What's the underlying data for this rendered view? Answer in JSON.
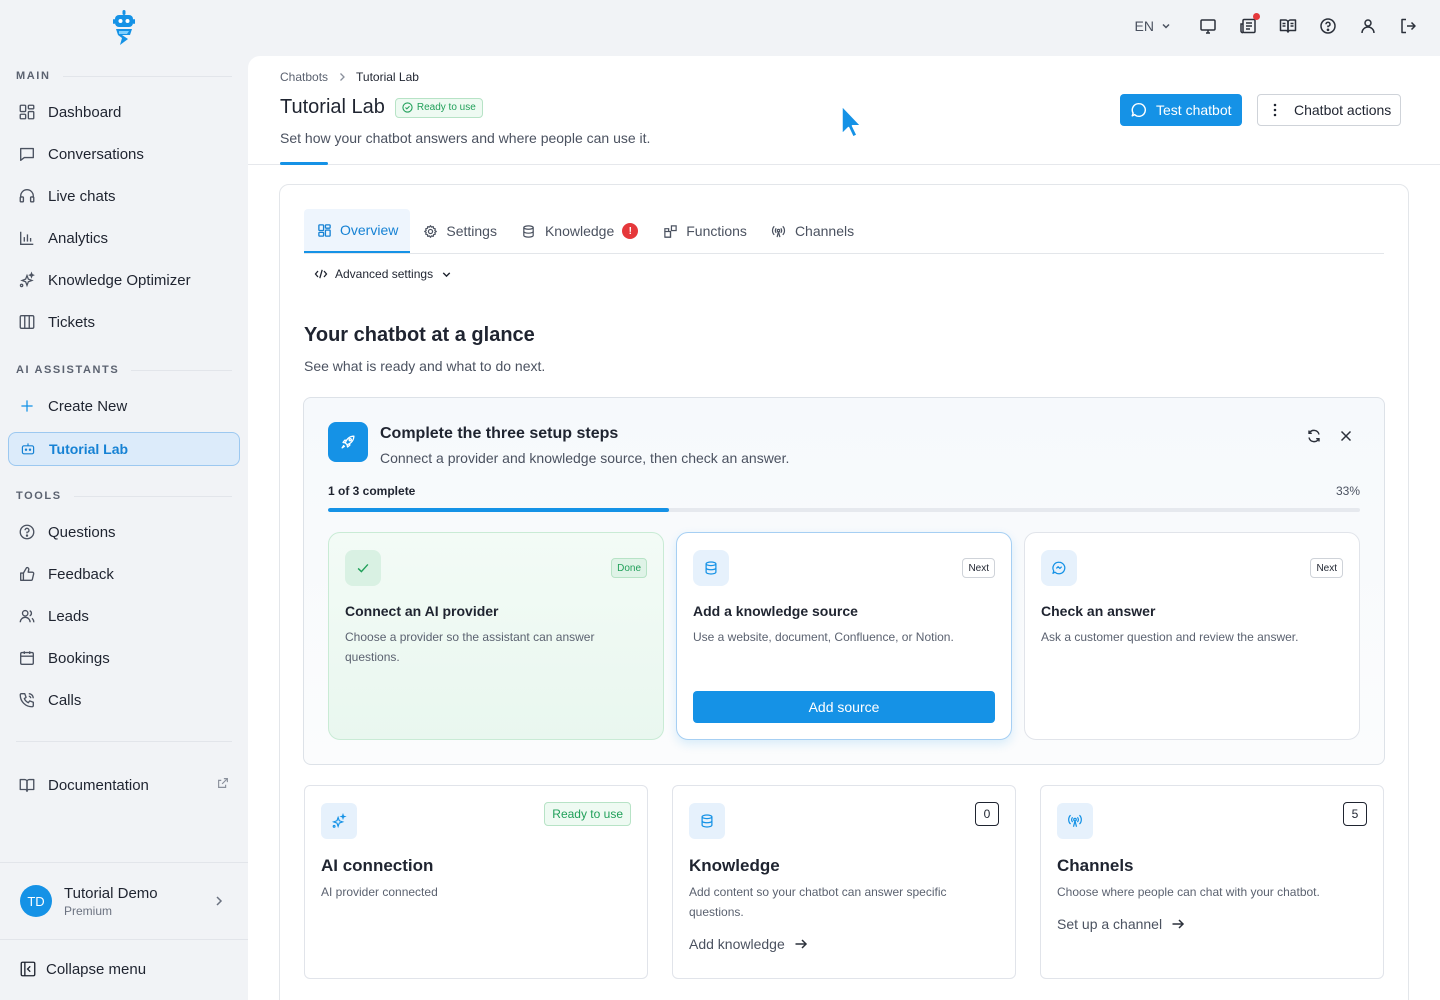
{
  "sidebar": {
    "sections": {
      "main": "MAIN",
      "ai_assistants": "AI ASSISTANTS",
      "tools": "TOOLS"
    },
    "main_items": [
      {
        "label": "Dashboard",
        "icon": "dashboard-icon"
      },
      {
        "label": "Conversations",
        "icon": "chat-icon"
      },
      {
        "label": "Live chats",
        "icon": "headset-icon"
      },
      {
        "label": "Analytics",
        "icon": "bar-chart-icon"
      },
      {
        "label": "Knowledge Optimizer",
        "icon": "sparkles-icon"
      },
      {
        "label": "Tickets",
        "icon": "columns-icon"
      }
    ],
    "assistant_items": [
      {
        "label": "Create New",
        "icon": "plus-icon"
      },
      {
        "label": "Tutorial Lab",
        "icon": "bot-icon",
        "active": true
      }
    ],
    "tool_items": [
      {
        "label": "Questions",
        "icon": "help-circle-icon"
      },
      {
        "label": "Feedback",
        "icon": "thumbs-up-icon"
      },
      {
        "label": "Leads",
        "icon": "users-icon"
      },
      {
        "label": "Bookings",
        "icon": "calendar-icon"
      },
      {
        "label": "Calls",
        "icon": "phone-icon"
      }
    ],
    "documentation": "Documentation",
    "user": {
      "initials": "TD",
      "name": "Tutorial Demo",
      "plan": "Premium"
    },
    "collapse_label": "Collapse menu"
  },
  "topbar": {
    "language": "EN",
    "icons": [
      "monitor-icon",
      "news-icon",
      "book-open-icon",
      "help-icon",
      "user-icon",
      "logout-icon"
    ]
  },
  "header": {
    "breadcrumb": [
      "Chatbots",
      "Tutorial Lab"
    ],
    "title": "Tutorial Lab",
    "status": "Ready to use",
    "subtitle": "Set how your chatbot answers and where people can use it.",
    "test_button": "Test chatbot",
    "actions_button": "Chatbot actions"
  },
  "tabs": [
    {
      "label": "Overview",
      "icon": "grid-icon",
      "active": true
    },
    {
      "label": "Settings",
      "icon": "gear-icon"
    },
    {
      "label": "Knowledge",
      "icon": "database-icon",
      "alert": "!"
    },
    {
      "label": "Functions",
      "icon": "blocks-icon"
    },
    {
      "label": "Channels",
      "icon": "broadcast-icon"
    }
  ],
  "advanced_settings": "Advanced settings",
  "overview": {
    "title": "Your chatbot at a glance",
    "subtitle": "See what is ready and what to do next."
  },
  "setup": {
    "title": "Complete the three setup steps",
    "subtitle": "Connect a provider and knowledge source, then check an answer.",
    "progress_label": "1 of 3 complete",
    "progress_pct_label": "33%",
    "progress_fraction": 0.33,
    "steps": [
      {
        "badge": "Done",
        "title": "Connect an AI provider",
        "desc": "Choose a provider so the assistant can answer questions.",
        "state": "done"
      },
      {
        "badge": "Next",
        "title": "Add a knowledge source",
        "desc": "Use a website, document, Confluence, or Notion.",
        "button": "Add source",
        "state": "current"
      },
      {
        "badge": "Next",
        "title": "Check an answer",
        "desc": "Ask a customer question and review the answer.",
        "state": "pending"
      }
    ]
  },
  "stats": [
    {
      "title": "AI connection",
      "desc": "AI provider connected",
      "badge": "Ready to use"
    },
    {
      "title": "Knowledge",
      "desc": "Add content so your chatbot can answer specific questions.",
      "count": "0",
      "link": "Add knowledge"
    },
    {
      "title": "Channels",
      "desc": "Choose where people can chat with your chatbot.",
      "count": "5",
      "link": "Set up a channel"
    }
  ],
  "colors": {
    "accent": "#1592e6",
    "success": "#21a05a",
    "alert": "#e5383b"
  }
}
